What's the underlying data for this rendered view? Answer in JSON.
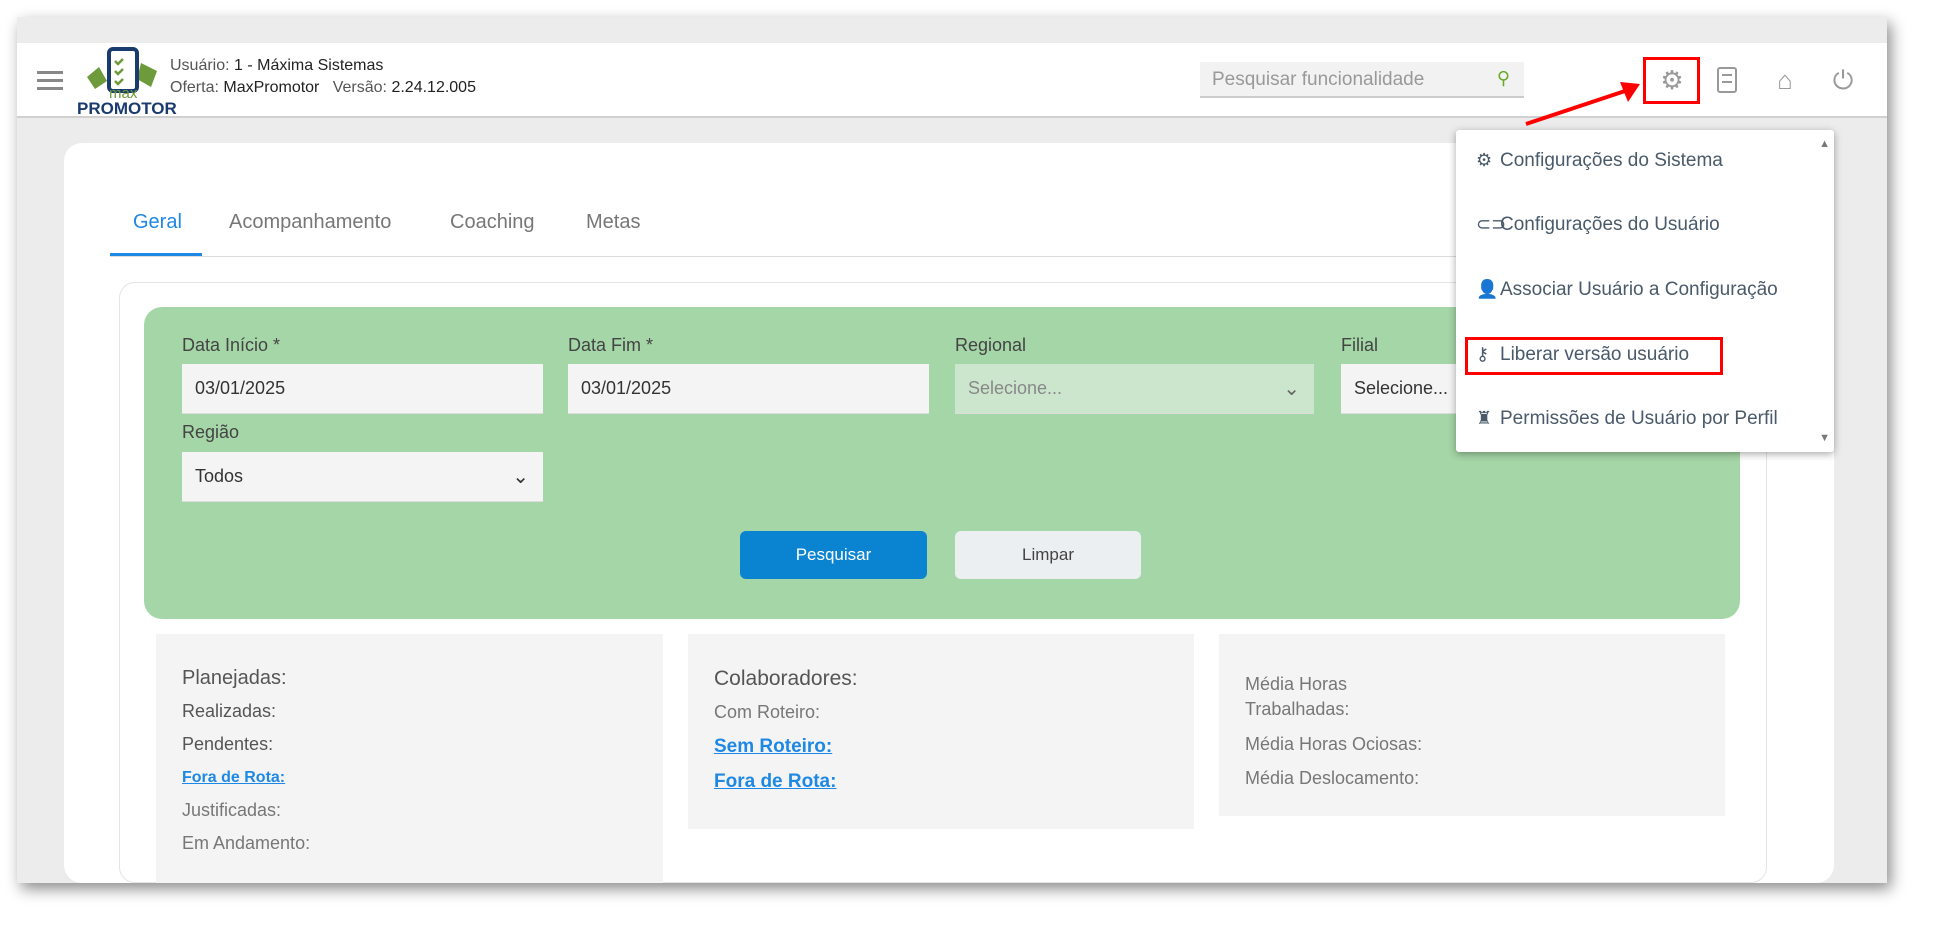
{
  "header": {
    "user_label": "Usuário:",
    "user_value": "1 - Máxima Sistemas",
    "offer_label": "Oferta:",
    "offer_value": "MaxPromotor",
    "version_label": "Versão:",
    "version_value": "2.24.12.005",
    "logo_top": "max",
    "logo_bottom": "PROMOTOR",
    "search_placeholder": "Pesquisar funcionalidade"
  },
  "tabs": [
    {
      "label": "Geral",
      "active": true
    },
    {
      "label": "Acompanhamento"
    },
    {
      "label": "Coaching"
    },
    {
      "label": "Metas"
    }
  ],
  "filters": {
    "data_inicio_label": "Data Início *",
    "data_inicio_value": "03/01/2025",
    "data_fim_label": "Data Fim *",
    "data_fim_value": "03/01/2025",
    "regional_label": "Regional",
    "regional_placeholder": "Selecione...",
    "filial_label": "Filial",
    "filial_placeholder": "Selecione...",
    "regiao_label": "Região",
    "regiao_value": "Todos",
    "search_button": "Pesquisar",
    "clear_button": "Limpar"
  },
  "stats": {
    "visits": [
      "Planejadas:",
      "Realizadas:",
      "Pendentes:",
      "Fora de Rota:",
      "Justificadas:",
      "Em Andamento:"
    ],
    "collaborators": [
      "Colaboradores:",
      "Com Roteiro:",
      "Sem Roteiro:",
      "Fora de Rota:"
    ],
    "hours": [
      "Média Horas",
      "Trabalhadas:",
      "Média Horas Ociosas:",
      "Média Deslocamento:"
    ]
  },
  "settings_menu": {
    "items": [
      "Configurações do Sistema",
      "Configurações do Usuário",
      "Associar Usuário a Configuração",
      "Liberar versão usuário",
      "Permissões de Usuário por Perfil"
    ]
  },
  "colors": {
    "accent": "#1e88e5",
    "filter_bg": "#a5d6a7",
    "highlight": "#ff0000"
  }
}
